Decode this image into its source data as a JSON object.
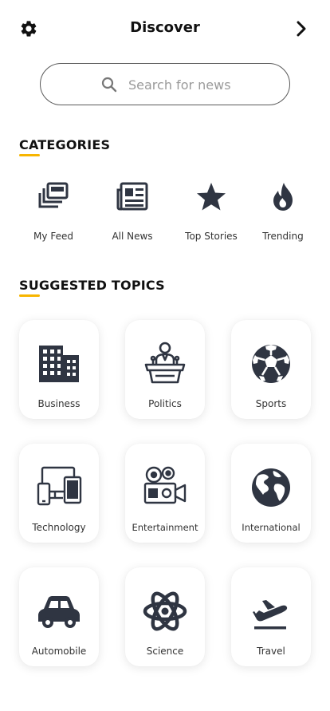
{
  "header": {
    "title": "Discover",
    "settings_icon": "gear-icon",
    "next_icon": "chevron-right-icon"
  },
  "search": {
    "placeholder": "Search for news",
    "value": "",
    "icon": "search-icon"
  },
  "categories": {
    "heading": "CATEGORIES",
    "items": [
      {
        "label": "My Feed",
        "icon": "feed-stack-icon"
      },
      {
        "label": "All News",
        "icon": "newspaper-icon"
      },
      {
        "label": "Top Stories",
        "icon": "star-icon"
      },
      {
        "label": "Trending",
        "icon": "flame-icon"
      }
    ]
  },
  "topics": {
    "heading": "SUGGESTED TOPICS",
    "items": [
      {
        "label": "Business",
        "icon": "building-icon"
      },
      {
        "label": "Politics",
        "icon": "podium-speaker-icon"
      },
      {
        "label": "Sports",
        "icon": "soccer-ball-icon"
      },
      {
        "label": "Technology",
        "icon": "devices-icon"
      },
      {
        "label": "Entertainment",
        "icon": "film-camera-icon"
      },
      {
        "label": "International",
        "icon": "globe-icon"
      },
      {
        "label": "Automobile",
        "icon": "car-icon"
      },
      {
        "label": "Science",
        "icon": "atom-icon"
      },
      {
        "label": "Travel",
        "icon": "plane-departure-icon"
      }
    ]
  },
  "colors": {
    "accent": "#f7b500",
    "icon": "#2f3542",
    "text": "#111111"
  }
}
